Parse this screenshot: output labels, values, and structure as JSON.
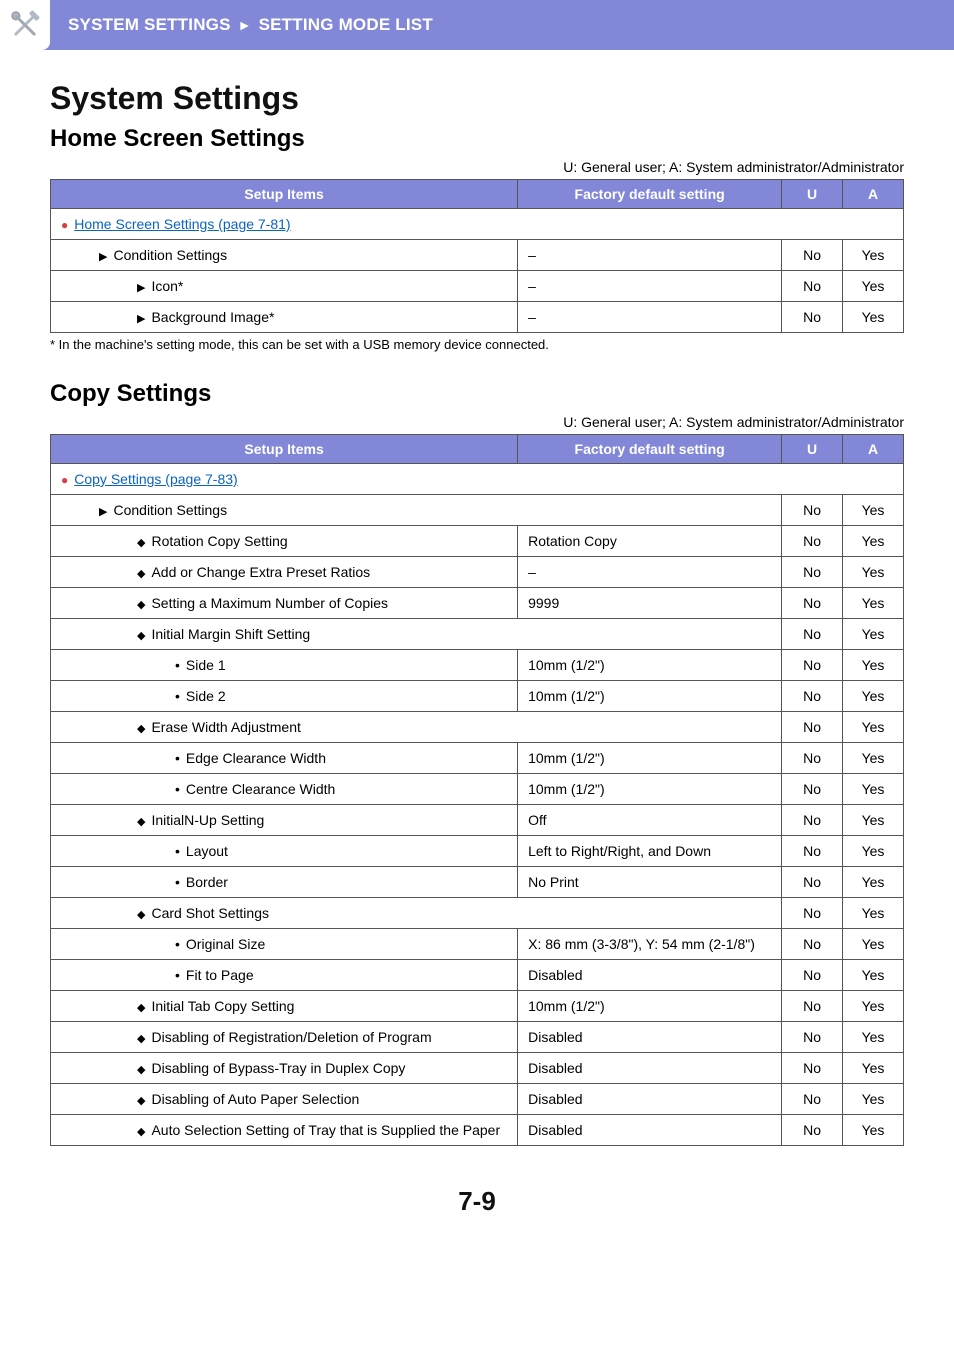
{
  "header": {
    "breadcrumb1": "SYSTEM SETTINGS",
    "arrow": "►",
    "breadcrumb2": "SETTING MODE LIST"
  },
  "page": {
    "title": "System Settings",
    "page_number": "7-9"
  },
  "home": {
    "section_title": "Home Screen Settings",
    "legend": "U: General user; A: System administrator/Administrator",
    "footnote": "*    In the machine's setting mode, this can be set with a USB memory device connected.",
    "headers": {
      "setup": "Setup Items",
      "factory": "Factory default setting",
      "u": "U",
      "a": "A"
    },
    "rows": [
      {
        "type": "group",
        "label": "Home Screen Settings (page 7-81)"
      },
      {
        "type": "item",
        "level": 1,
        "bullet": "tri",
        "label": "Condition Settings",
        "factory": "–",
        "u": "No",
        "a": "Yes"
      },
      {
        "type": "item",
        "level": 2,
        "bullet": "tri",
        "label": "Icon*",
        "factory": "–",
        "u": "No",
        "a": "Yes"
      },
      {
        "type": "item",
        "level": 2,
        "bullet": "tri",
        "label": "Background Image*",
        "factory": "–",
        "u": "No",
        "a": "Yes"
      }
    ]
  },
  "copy": {
    "section_title": "Copy Settings",
    "legend": "U: General user; A: System administrator/Administrator",
    "headers": {
      "setup": "Setup Items",
      "factory": "Factory default setting",
      "u": "U",
      "a": "A"
    },
    "rows": [
      {
        "type": "group",
        "label": "Copy Settings (page 7-83)"
      },
      {
        "type": "item",
        "level": 1,
        "bullet": "tri",
        "label": "Condition Settings",
        "factory": "",
        "span": true,
        "u": "No",
        "a": "Yes"
      },
      {
        "type": "item",
        "level": 2,
        "bullet": "diamond",
        "label": "Rotation Copy Setting",
        "factory": "Rotation Copy",
        "u": "No",
        "a": "Yes"
      },
      {
        "type": "item",
        "level": 2,
        "bullet": "diamond",
        "label": "Add or Change Extra Preset Ratios",
        "factory": "–",
        "u": "No",
        "a": "Yes"
      },
      {
        "type": "item",
        "level": 2,
        "bullet": "diamond",
        "label": "Setting a Maximum Number of Copies",
        "factory": "9999",
        "u": "No",
        "a": "Yes"
      },
      {
        "type": "item",
        "level": 2,
        "bullet": "diamond",
        "label": "Initial Margin Shift Setting",
        "factory": "",
        "span": true,
        "u": "No",
        "a": "Yes"
      },
      {
        "type": "item",
        "level": 3,
        "bullet": "dot",
        "label": "Side 1",
        "factory": "10mm (1/2\")",
        "u": "No",
        "a": "Yes"
      },
      {
        "type": "item",
        "level": 3,
        "bullet": "dot",
        "label": "Side 2",
        "factory": "10mm (1/2\")",
        "u": "No",
        "a": "Yes"
      },
      {
        "type": "item",
        "level": 2,
        "bullet": "diamond",
        "label": "Erase Width Adjustment",
        "factory": "",
        "span": true,
        "u": "No",
        "a": "Yes"
      },
      {
        "type": "item",
        "level": 3,
        "bullet": "dot",
        "label": "Edge Clearance Width",
        "factory": "10mm (1/2\")",
        "u": "No",
        "a": "Yes"
      },
      {
        "type": "item",
        "level": 3,
        "bullet": "dot",
        "label": "Centre Clearance Width",
        "factory": "10mm (1/2\")",
        "u": "No",
        "a": "Yes"
      },
      {
        "type": "item",
        "level": 2,
        "bullet": "diamond",
        "label": "InitialN-Up Setting",
        "factory": "Off",
        "u": "No",
        "a": "Yes"
      },
      {
        "type": "item",
        "level": 3,
        "bullet": "dot",
        "label": "Layout",
        "factory": "Left to Right/Right, and Down",
        "u": "No",
        "a": "Yes"
      },
      {
        "type": "item",
        "level": 3,
        "bullet": "dot",
        "label": "Border",
        "factory": "No Print",
        "u": "No",
        "a": "Yes"
      },
      {
        "type": "item",
        "level": 2,
        "bullet": "diamond",
        "label": "Card Shot Settings",
        "factory": "",
        "span": true,
        "u": "No",
        "a": "Yes"
      },
      {
        "type": "item",
        "level": 3,
        "bullet": "dot",
        "label": "Original Size",
        "factory": "X: 86 mm (3-3/8\"), Y: 54 mm (2-1/8\")",
        "u": "No",
        "a": "Yes"
      },
      {
        "type": "item",
        "level": 3,
        "bullet": "dot",
        "label": "Fit to Page",
        "factory": "Disabled",
        "u": "No",
        "a": "Yes"
      },
      {
        "type": "item",
        "level": 2,
        "bullet": "diamond",
        "label": "Initial Tab Copy Setting",
        "factory": "10mm (1/2\")",
        "u": "No",
        "a": "Yes"
      },
      {
        "type": "item",
        "level": 2,
        "bullet": "diamond",
        "label": "Disabling of Registration/Deletion of Program",
        "factory": "Disabled",
        "u": "No",
        "a": "Yes"
      },
      {
        "type": "item",
        "level": 2,
        "bullet": "diamond",
        "label": "Disabling of Bypass-Tray in Duplex Copy",
        "factory": "Disabled",
        "u": "No",
        "a": "Yes"
      },
      {
        "type": "item",
        "level": 2,
        "bullet": "diamond",
        "label": "Disabling of Auto Paper Selection",
        "factory": "Disabled",
        "u": "No",
        "a": "Yes"
      },
      {
        "type": "item",
        "level": 2,
        "bullet": "diamond",
        "label": "Auto Selection Setting of Tray that is Supplied the Paper",
        "factory": "Disabled",
        "u": "No",
        "a": "Yes"
      }
    ]
  }
}
